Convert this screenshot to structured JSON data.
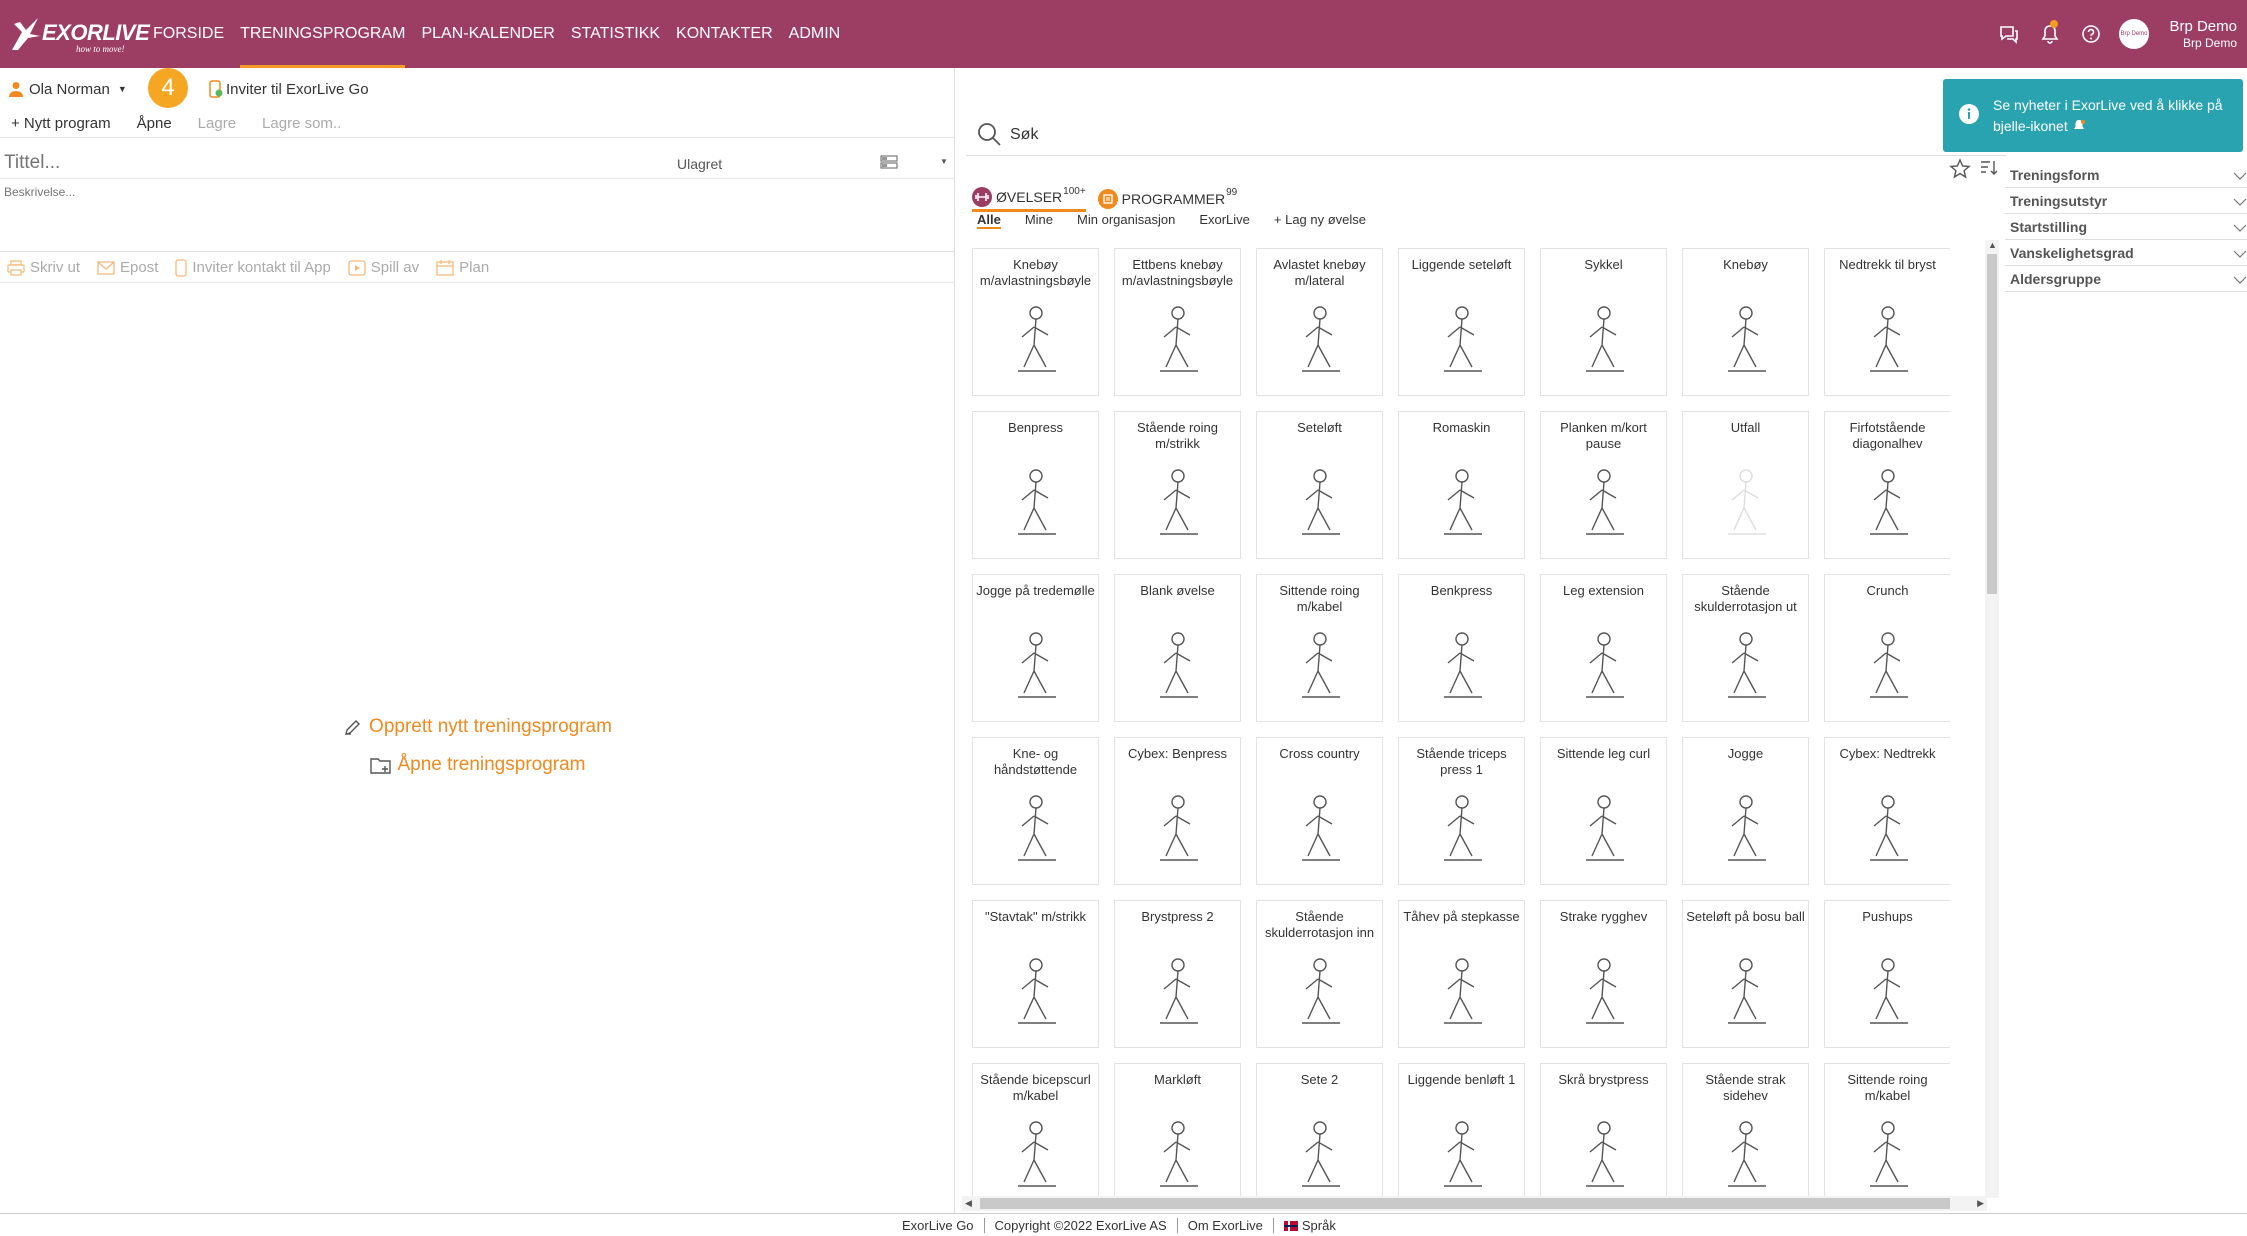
{
  "app": {
    "logo_text": "EXORLIVE",
    "logo_tagline": "how to move!"
  },
  "nav": [
    {
      "label": "FORSIDE",
      "active": false
    },
    {
      "label": "TRENINGSPROGRAM",
      "active": true
    },
    {
      "label": "PLAN-KALENDER",
      "active": false
    },
    {
      "label": "STATISTIKK",
      "active": false
    },
    {
      "label": "KONTAKTER",
      "active": false
    },
    {
      "label": "ADMIN",
      "active": false
    }
  ],
  "user": {
    "name": "Brp Demo",
    "org": "Brp Demo",
    "avatar_text": "Brp Demo"
  },
  "client": {
    "name": "Ola Norman",
    "step_badge": "4",
    "invite_go": "Inviter til ExorLive Go"
  },
  "toolbar": {
    "new_program": "+ Nytt program",
    "open": "Åpne",
    "save": "Lagre",
    "save_as": "Lagre som.."
  },
  "program": {
    "title_placeholder": "Tittel...",
    "status": "Ulagret",
    "description_placeholder": "Beskrivelse..."
  },
  "actions": {
    "print": "Skriv ut",
    "email": "Epost",
    "invite_app": "Inviter kontakt til App",
    "play": "Spill av",
    "plan": "Plan"
  },
  "empty_state": {
    "create": "Opprett nytt treningsprogram",
    "open": "Åpne treningsprogram"
  },
  "search": {
    "placeholder": "Søk"
  },
  "tabs": {
    "exercises": "ØVELSER",
    "exercises_count": "100+",
    "programs": "PROGRAMMER",
    "programs_count": "99"
  },
  "subtabs": [
    {
      "label": "Alle",
      "active": true
    },
    {
      "label": "Mine",
      "active": false
    },
    {
      "label": "Min organisasjon",
      "active": false
    },
    {
      "label": "ExorLive",
      "active": false
    },
    {
      "label": "+ Lag ny øvelse",
      "active": false
    }
  ],
  "exercises": [
    "Knebøy m/avlastningsbøyle",
    "Ettbens knebøy m/avlastningsbøyle",
    "Avlastet knebøy m/lateral",
    "Liggende seteløft",
    "Sykkel",
    "Knebøy",
    "Nedtrekk til bryst",
    "Benpress",
    "Stående roing m/strikk",
    "Seteløft",
    "Romaskin",
    "Planken m/kort pause",
    "Utfall",
    "Firfotstående diagonalhev",
    "Jogge på tredemølle",
    "Blank øvelse",
    "Sittende roing m/kabel",
    "Benkpress",
    "Leg extension",
    "Stående skulderrotasjon ut",
    "Crunch",
    "Kne- og håndstøttende",
    "Cybex: Benpress",
    "Cross country",
    "Stående triceps press 1",
    "Sittende leg curl",
    "Jogge",
    "Cybex: Nedtrekk",
    "\"Stavtak\" m/strikk",
    "Brystpress 2",
    "Stående skulderrotasjon inn",
    "Tåhev på stepkasse",
    "Strake rygghev",
    "Seteløft på bosu ball",
    "Pushups",
    "Stående bicepscurl m/kabel",
    "Markløft",
    "Sete 2",
    "Liggende benløft 1",
    "Skrå brystpress",
    "Stående strak sidehev",
    "Sittende roing m/kabel"
  ],
  "selected_exercise": "Utfall",
  "filters": [
    "Treningsform",
    "Treningsutstyr",
    "Startstilling",
    "Vanskelighetsgrad",
    "Aldersgruppe"
  ],
  "toast": {
    "text": "Se nyheter i ExorLive ved å klikke på bjelle-ikonet"
  },
  "footer": [
    "ExorLive Go",
    "Copyright ©2022 ExorLive AS",
    "Om ExorLive",
    "Språk"
  ],
  "colors": {
    "brand": "#9c3d63",
    "accent": "#f08a1e",
    "toast": "#2aa3b0"
  }
}
